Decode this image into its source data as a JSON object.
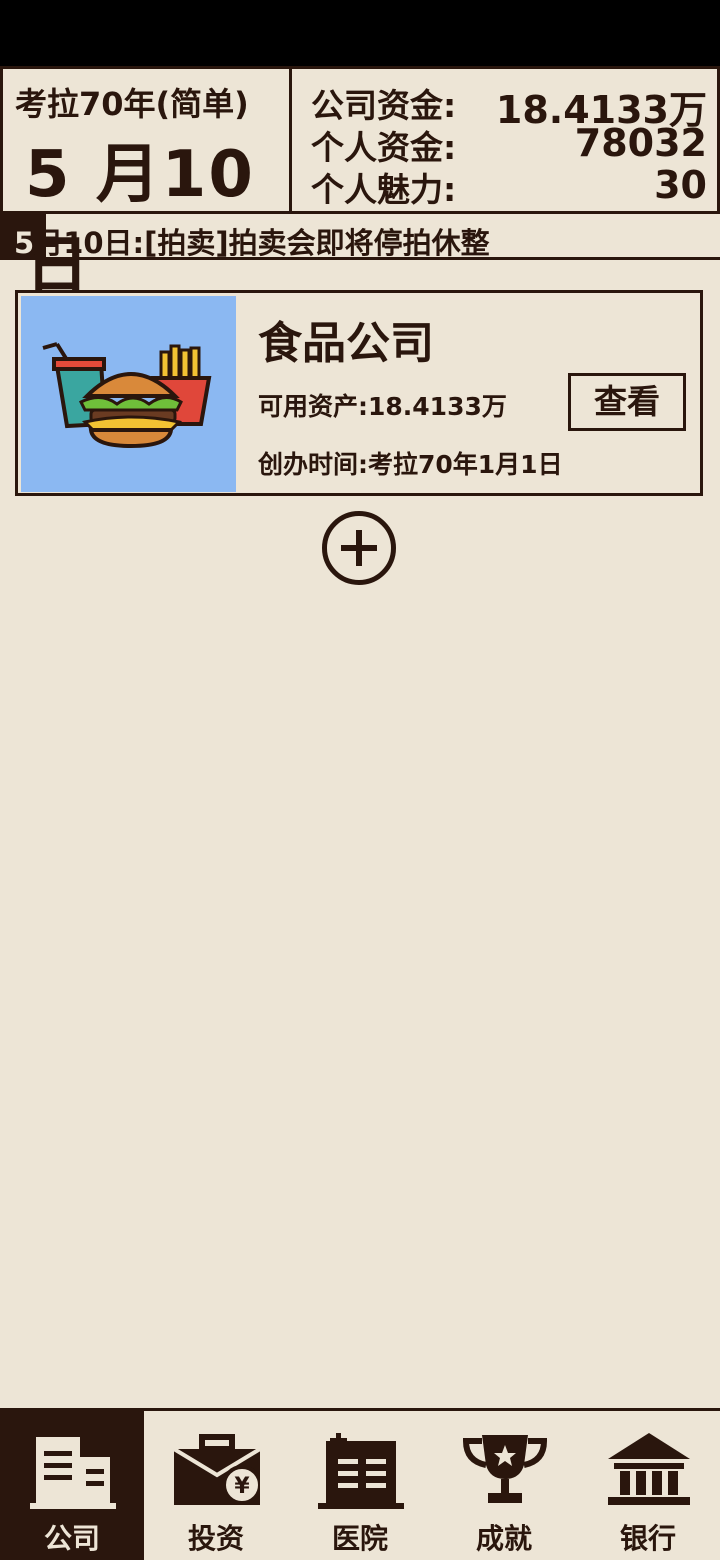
{
  "header": {
    "year_label": "考拉70年(简单)",
    "date_label": "5 月10 日",
    "stats": [
      {
        "label": "公司资金:",
        "value": "18.4133万"
      },
      {
        "label": "个人资金:",
        "value": "78032"
      },
      {
        "label": "个人魅力:",
        "value": "30"
      }
    ]
  },
  "ticker": {
    "first_char": "5",
    "text": "月10日:[拍卖]拍卖会即将停拍休整"
  },
  "company_card": {
    "title": "食品公司",
    "asset": "可用资产:18.4133万",
    "founded": "创办时间:考拉70年1月1日",
    "view_label": "查看",
    "image_icon": "burger-fries-drink-icon"
  },
  "add_icon": "plus-circle-icon",
  "nav": {
    "items": [
      {
        "label": "公司",
        "icon": "office-building-icon",
        "active": true
      },
      {
        "label": "投资",
        "icon": "briefcase-yen-icon",
        "active": false
      },
      {
        "label": "医院",
        "icon": "hospital-icon",
        "active": false
      },
      {
        "label": "成就",
        "icon": "trophy-icon",
        "active": false
      },
      {
        "label": "银行",
        "icon": "bank-icon",
        "active": false
      }
    ]
  },
  "colors": {
    "background": "#ede5d6",
    "ink": "#2a160d",
    "card_image_bg": "#8bb8f2"
  }
}
